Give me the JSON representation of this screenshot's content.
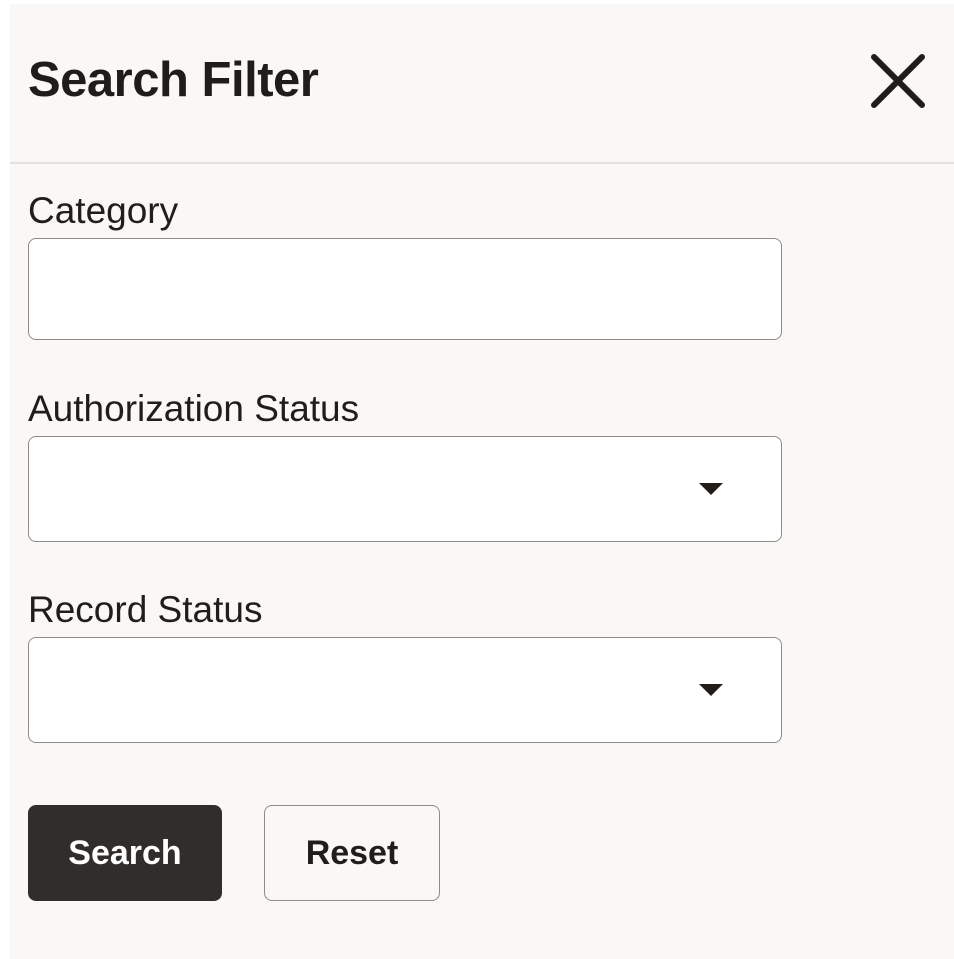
{
  "header": {
    "title": "Search Filter",
    "close_icon": "close-icon"
  },
  "fields": {
    "category": {
      "label": "Category",
      "value": "",
      "placeholder": ""
    },
    "authorization_status": {
      "label": "Authorization Status",
      "value": "",
      "icon": "chevron-down-icon"
    },
    "record_status": {
      "label": "Record Status",
      "value": "",
      "icon": "chevron-down-icon"
    }
  },
  "actions": {
    "search_label": "Search",
    "reset_label": "Reset"
  },
  "colors": {
    "panel_bg": "#f9f8f6",
    "primary_button": "#312d2a",
    "text": "#201d1b",
    "border": "#8f8b87"
  }
}
